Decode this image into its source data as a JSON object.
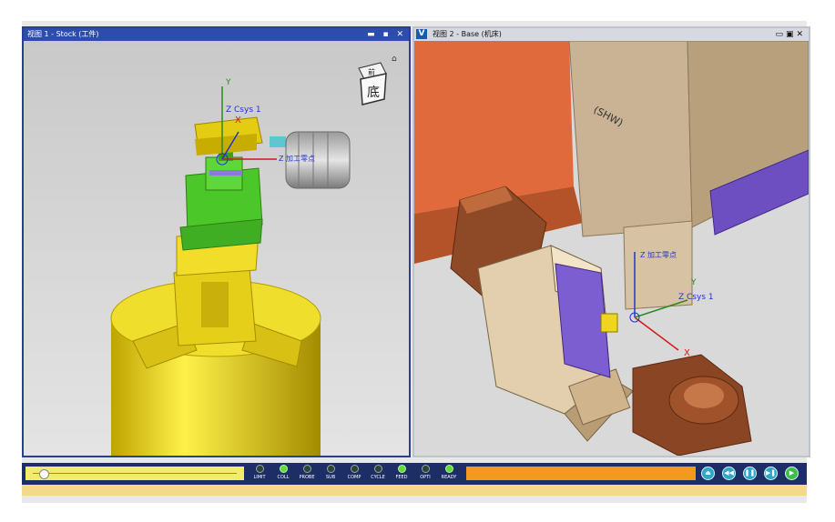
{
  "view1": {
    "title": "视图 1 - Stock (工件)",
    "window_buttons": "▬ ▪ ✕",
    "nav_cube": {
      "top_label": "前",
      "front_label": "底"
    },
    "axis": {
      "z_label": "Z Csys 1",
      "x_label": "X",
      "y_label": "Y",
      "ref_label": "Z 加工零点"
    }
  },
  "view2": {
    "title": "视图 2 - Base (机床)",
    "logo_letter": "V",
    "window_buttons": "▭▣✕",
    "axis": {
      "z_label": "Z Csys 1",
      "x_label": "X",
      "y_label": "Y",
      "ref_label": "Z 加工零点"
    },
    "spindle_text": "(SHW)"
  },
  "control": {
    "slider_position": 0.04,
    "leds": [
      {
        "label": "LIMIT",
        "on": false
      },
      {
        "label": "COLL",
        "on": true
      },
      {
        "label": "PROBE",
        "on": false
      },
      {
        "label": "SUB",
        "on": false
      },
      {
        "label": "COMP",
        "on": false
      },
      {
        "label": "CYCLE",
        "on": false
      },
      {
        "label": "FEED",
        "on": true
      },
      {
        "label": "OPTI",
        "on": false
      },
      {
        "label": "READY",
        "on": true
      }
    ],
    "buttons": [
      {
        "name": "eject-button",
        "icon": "eject-icon",
        "glyph": "⏏"
      },
      {
        "name": "rewind-button",
        "icon": "rewind-icon",
        "glyph": "◀◀"
      },
      {
        "name": "pause-button",
        "icon": "pause-icon",
        "glyph": "❚❚"
      },
      {
        "name": "step-button",
        "icon": "step-forward-icon",
        "glyph": "▶❚"
      },
      {
        "name": "play-button",
        "icon": "play-icon",
        "glyph": "▶"
      }
    ]
  },
  "colors": {
    "active_border": "#2a3e94",
    "chuck": "#e3cc12",
    "fixture": "#4cc72a",
    "machine_body": "#c9b394",
    "accent_purple": "#6e4fc2",
    "progress": "#f29a1c"
  }
}
